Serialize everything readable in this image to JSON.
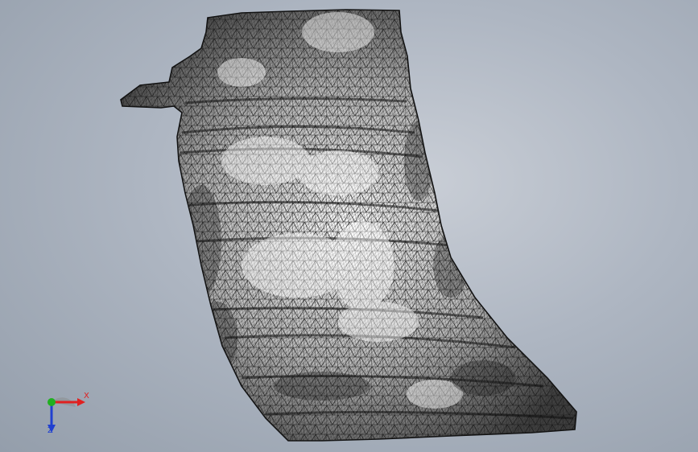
{
  "viewport": {
    "background_top": "#c9ced6",
    "background_bottom": "#949eab"
  },
  "model": {
    "mesh_edge_color": "#1a1a1a",
    "surface_light": "#ffffff",
    "surface_dark": "#3a3a3a"
  },
  "triad": {
    "x_label": "X",
    "z_label": "Z",
    "x_color": "#e02020",
    "y_color": "#20b020",
    "z_color": "#2040d0"
  }
}
